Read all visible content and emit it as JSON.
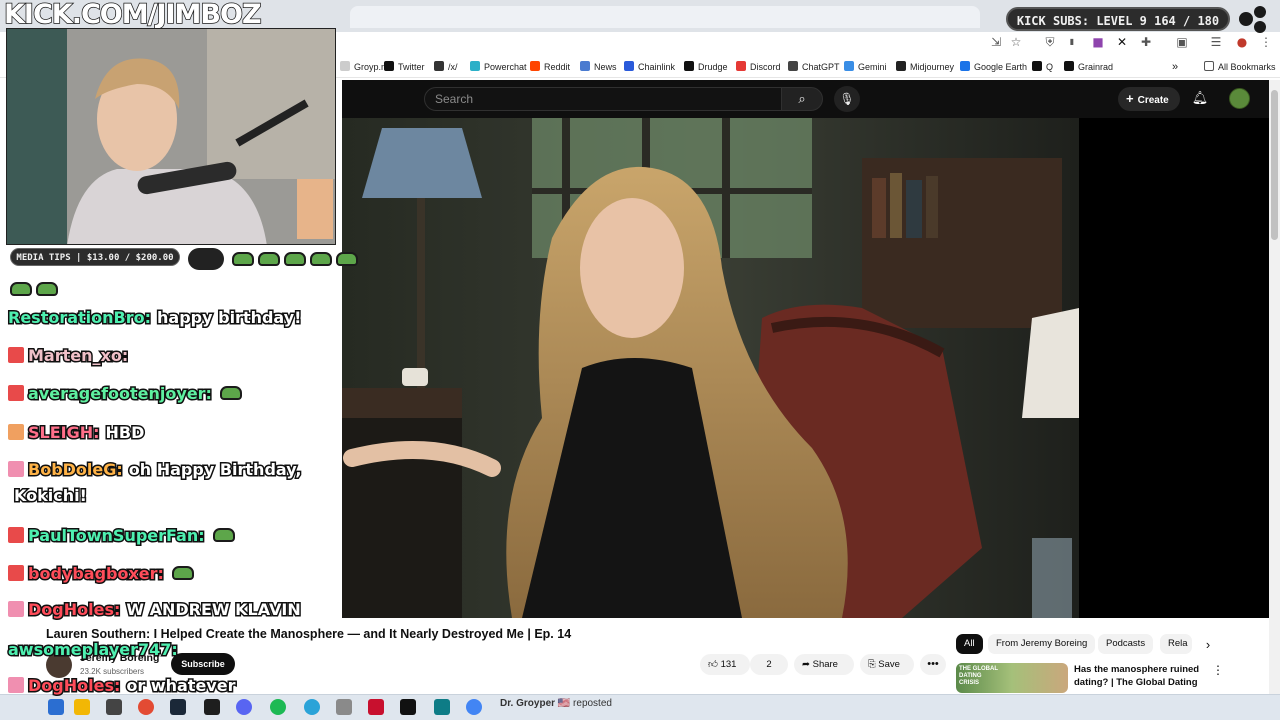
{
  "stream_overlay": {
    "banner_text": "KICK.COM/JIMBOZ",
    "kick_subs": "KICK SUBS: LEVEL 9 164 / 180",
    "media_tips": "MEDIA TIPS | $13.00 / $200.00",
    "chat": [
      {
        "user": "RestorationBro:",
        "message": "happy birthday!",
        "color": "#4ef0b0"
      },
      {
        "user": "Marten_xo:",
        "message": "",
        "color": "#f0c0c8"
      },
      {
        "user": "averagefootenjoyer:",
        "message": "",
        "color": "#5ef0a0"
      },
      {
        "user": "SLEIGH:",
        "message": "HBD",
        "color": "#ff6f8a"
      },
      {
        "user": "BobDoleG:",
        "message": "oh Happy Birthday,",
        "color": "#ffb347"
      },
      {
        "user": "",
        "message": "Kokichi!",
        "color": "#ffffff"
      },
      {
        "user": "PaulTownSuperFan:",
        "message": "",
        "color": "#4ef0b0"
      },
      {
        "user": "bodybagboxer:",
        "message": "",
        "color": "#ff4d5a"
      },
      {
        "user": "DogHoles:",
        "message": "W ANDREW KLAVIN",
        "color": "#ff4d5a"
      },
      {
        "user": "awsomeplayer747:",
        "message": "",
        "color": "#4ef0b0"
      },
      {
        "user": "DogHoles:",
        "message": "or whatever",
        "color": "#ff4d5a"
      }
    ]
  },
  "browser": {
    "bookmarks": [
      {
        "label": "Groyp.me",
        "color": "#cccccc"
      },
      {
        "label": "Twitter",
        "color": "#111111"
      },
      {
        "label": "/x/",
        "color": "#333333"
      },
      {
        "label": "Powerchat",
        "color": "#2bb0c8"
      },
      {
        "label": "Reddit",
        "color": "#ff4500"
      },
      {
        "label": "News",
        "color": "#4a7bd0"
      },
      {
        "label": "Chainlink",
        "color": "#2a5ada"
      },
      {
        "label": "Drudge",
        "color": "#111111"
      },
      {
        "label": "Discord",
        "color": "#e53935"
      },
      {
        "label": "ChatGPT",
        "color": "#444444"
      },
      {
        "label": "Gemini",
        "color": "#3a8ee6"
      },
      {
        "label": "Midjourney",
        "color": "#222222"
      },
      {
        "label": "Google Earth",
        "color": "#1a73e8"
      },
      {
        "label": "Q",
        "color": "#111111"
      },
      {
        "label": "Grainrad",
        "color": "#111111"
      }
    ],
    "all_bookmarks": "All Bookmarks",
    "overflow": "»"
  },
  "youtube": {
    "search_placeholder": "Search",
    "create_label": "Create",
    "video_title": "Lauren Southern: I Helped Create the Manosphere — and It Nearly Destroyed Me | Ep. 14",
    "channel_name": "Jeremy Boreing",
    "channel_subs": "23.2K subscribers",
    "subscribe_label": "Subscribe",
    "likes": "131",
    "dislikes": "2",
    "share_label": "Share",
    "save_label": "Save",
    "more_label": "•••",
    "chips": [
      "All",
      "From Jeremy Boreing",
      "Podcasts",
      "Rela"
    ],
    "recommendation": {
      "title": "Has the manosphere ruined dating? | The Global Dating ...",
      "thumb_text": "THE GLOBAL DATING CRISIS"
    },
    "overlay_logo": "B"
  },
  "below_fold": {
    "repost_user": "Dr. Groyper",
    "repost_label": "reposted"
  }
}
